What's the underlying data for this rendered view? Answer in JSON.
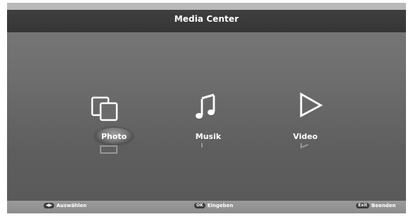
{
  "header": {
    "title": "Media Center"
  },
  "menu": {
    "items": [
      {
        "label": "Photo",
        "icon": "photo-icon",
        "selected": true
      },
      {
        "label": "Musik",
        "icon": "music-note-icon",
        "selected": false
      },
      {
        "label": "Video",
        "icon": "play-icon",
        "selected": false
      }
    ]
  },
  "footer": {
    "hints": [
      {
        "key": "◀▶",
        "label": "Auswählen"
      },
      {
        "key": "OK",
        "label": "Eingeben"
      },
      {
        "key": "Exit",
        "label": "Beenden"
      }
    ]
  },
  "colors": {
    "header_bg": "#3a3a3a",
    "screen_bg": "#6a6a6a",
    "footer_bg": "#959595",
    "text": "#ffffff"
  }
}
